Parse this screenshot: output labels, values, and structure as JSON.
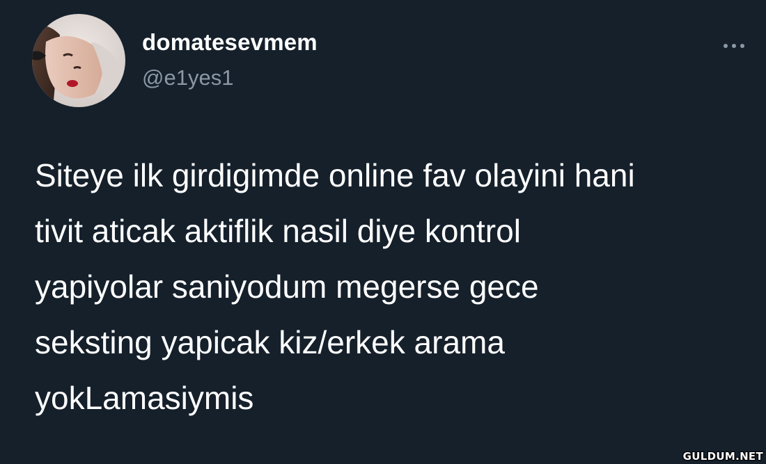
{
  "tweet": {
    "display_name": "domatesevmem",
    "handle": "@e1yes1",
    "text_lines": [
      "Siteye ilk girdigimde online fav olayini hani",
      "tivit aticak aktiflik nasil diye kontrol",
      "yapiyolar saniyodum megerse gece",
      "seksting yapicak kiz/erkek arama",
      "yokLamasiymis"
    ],
    "avatar_icon": "profile-photo",
    "more_icon": "more-horizontal-icon"
  },
  "watermark": {
    "text": "GULDUM.NET"
  },
  "colors": {
    "background": "#15202b",
    "primary_text": "#ffffff",
    "secondary_text": "#8b98a5"
  }
}
